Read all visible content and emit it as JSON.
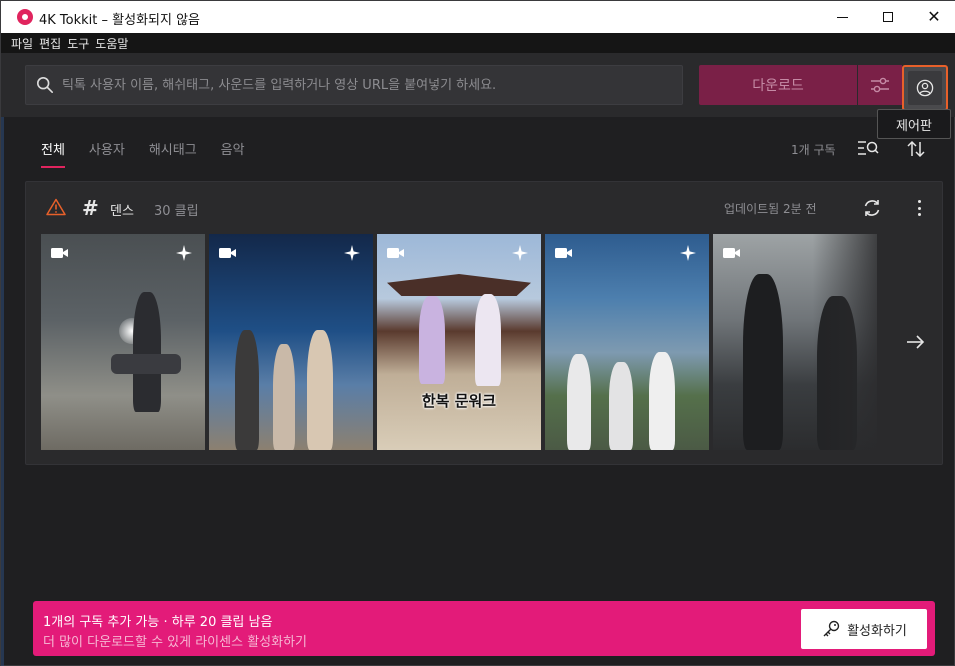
{
  "window": {
    "title": "4K Tokkit – 활성화되지 않음",
    "min_label": "",
    "max_label": "",
    "close_label": "✕"
  },
  "menu": [
    "파일",
    "편집",
    "도구",
    "도움말"
  ],
  "search": {
    "placeholder": "틱톡 사용자 이름, 해쉬태그, 사운드를 입력하거나 영상 URL을 붙여넣기 하세요.",
    "value": ""
  },
  "toolbar": {
    "download_label": "다운로드",
    "tooltip": "제어판"
  },
  "tabs": [
    {
      "label": "전체",
      "active": true
    },
    {
      "label": "사용자",
      "active": false
    },
    {
      "label": "해시태그",
      "active": false
    },
    {
      "label": "음악",
      "active": false
    }
  ],
  "subscriptions": {
    "count_label": "1개 구독"
  },
  "card": {
    "name": "덴스",
    "clip_count": "30 클립",
    "updated": "업데이트됨 2분 전",
    "thumbnails": [
      {
        "caption": ""
      },
      {
        "caption": ""
      },
      {
        "caption": "한복 문워크"
      },
      {
        "caption": ""
      },
      {
        "caption": ""
      }
    ]
  },
  "banner": {
    "line1": "1개의 구독 추가 가능 · 하루 20 클립 남음",
    "line2": "더 많이 다운로드할 수 있게 라이센스 활성화하기",
    "button_label": "활성화하기"
  },
  "colors": {
    "accent": "#e31b79",
    "download_disabled": "#7a2047",
    "highlight": "#e8602a",
    "warning": "#e8602a"
  },
  "icons": [
    "app-logo-icon",
    "search-icon",
    "sliders-icon",
    "account-icon",
    "list-search-icon",
    "sort-icon",
    "warning-icon",
    "hash-icon",
    "refresh-icon",
    "more-vertical-icon",
    "video-icon",
    "sparkle-icon",
    "arrow-right-icon",
    "key-icon"
  ]
}
